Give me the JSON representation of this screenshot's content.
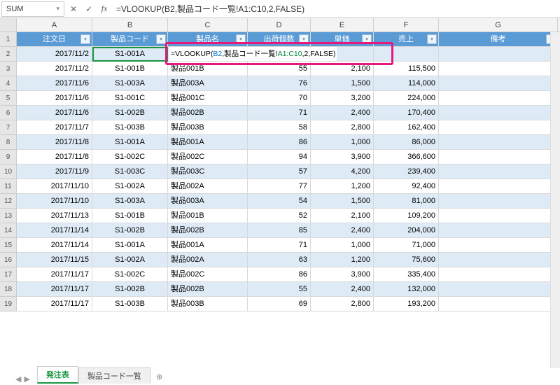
{
  "namebox": "SUM",
  "fb_cancel": "✕",
  "fb_confirm": "✓",
  "fb_fx": "fx",
  "formula": "=VLOOKUP(B2,製品コード一覧!A1:C10,2,FALSE)",
  "inline_prefix": "=VLOOKUP(",
  "inline_ref1": "B2",
  "inline_mid": ",製品コード一覧!",
  "inline_ref2": "A1:C10",
  "inline_suffix": ",2,FALSE)",
  "cols": {
    "A": "A",
    "B": "B",
    "C": "C",
    "D": "D",
    "E": "E",
    "F": "F",
    "G": "G"
  },
  "headers": {
    "A": "注文日",
    "B": "製品コード",
    "C": "製品名",
    "D": "出荷個数",
    "E": "単価",
    "F": "売上",
    "G": "備考"
  },
  "rows": [
    {
      "n": "2",
      "A": "2017/11/2",
      "B": "S1-001A",
      "C": "",
      "D": "",
      "E": "",
      "F": "",
      "alt": true
    },
    {
      "n": "3",
      "A": "2017/11/2",
      "B": "S1-001B",
      "C": "製品001B",
      "D": "55",
      "E": "2,100",
      "F": "115,500",
      "alt": false
    },
    {
      "n": "4",
      "A": "2017/11/6",
      "B": "S1-003A",
      "C": "製品003A",
      "D": "76",
      "E": "1,500",
      "F": "114,000",
      "alt": true
    },
    {
      "n": "5",
      "A": "2017/11/6",
      "B": "S1-001C",
      "C": "製品001C",
      "D": "70",
      "E": "3,200",
      "F": "224,000",
      "alt": false
    },
    {
      "n": "6",
      "A": "2017/11/6",
      "B": "S1-002B",
      "C": "製品002B",
      "D": "71",
      "E": "2,400",
      "F": "170,400",
      "alt": true
    },
    {
      "n": "7",
      "A": "2017/11/7",
      "B": "S1-003B",
      "C": "製品003B",
      "D": "58",
      "E": "2,800",
      "F": "162,400",
      "alt": false
    },
    {
      "n": "8",
      "A": "2017/11/8",
      "B": "S1-001A",
      "C": "製品001A",
      "D": "86",
      "E": "1,000",
      "F": "86,000",
      "alt": true
    },
    {
      "n": "9",
      "A": "2017/11/8",
      "B": "S1-002C",
      "C": "製品002C",
      "D": "94",
      "E": "3,900",
      "F": "366,600",
      "alt": false
    },
    {
      "n": "10",
      "A": "2017/11/9",
      "B": "S1-003C",
      "C": "製品003C",
      "D": "57",
      "E": "4,200",
      "F": "239,400",
      "alt": true
    },
    {
      "n": "11",
      "A": "2017/11/10",
      "B": "S1-002A",
      "C": "製品002A",
      "D": "77",
      "E": "1,200",
      "F": "92,400",
      "alt": false
    },
    {
      "n": "12",
      "A": "2017/11/10",
      "B": "S1-003A",
      "C": "製品003A",
      "D": "54",
      "E": "1,500",
      "F": "81,000",
      "alt": true
    },
    {
      "n": "13",
      "A": "2017/11/13",
      "B": "S1-001B",
      "C": "製品001B",
      "D": "52",
      "E": "2,100",
      "F": "109,200",
      "alt": false
    },
    {
      "n": "14",
      "A": "2017/11/14",
      "B": "S1-002B",
      "C": "製品002B",
      "D": "85",
      "E": "2,400",
      "F": "204,000",
      "alt": true
    },
    {
      "n": "15",
      "A": "2017/11/14",
      "B": "S1-001A",
      "C": "製品001A",
      "D": "71",
      "E": "1,000",
      "F": "71,000",
      "alt": false
    },
    {
      "n": "16",
      "A": "2017/11/15",
      "B": "S1-002A",
      "C": "製品002A",
      "D": "63",
      "E": "1,200",
      "F": "75,600",
      "alt": true
    },
    {
      "n": "17",
      "A": "2017/11/17",
      "B": "S1-002C",
      "C": "製品002C",
      "D": "86",
      "E": "3,900",
      "F": "335,400",
      "alt": false
    },
    {
      "n": "18",
      "A": "2017/11/17",
      "B": "S1-002B",
      "C": "製品002B",
      "D": "55",
      "E": "2,400",
      "F": "132,000",
      "alt": true
    },
    {
      "n": "19",
      "A": "2017/11/17",
      "B": "S1-003B",
      "C": "製品003B",
      "D": "69",
      "E": "2,800",
      "F": "193,200",
      "alt": false
    }
  ],
  "tabs": {
    "prev": "◀",
    "next": "▶",
    "active": "発注表",
    "other": "製品コード一覧",
    "plus": "⊕"
  }
}
